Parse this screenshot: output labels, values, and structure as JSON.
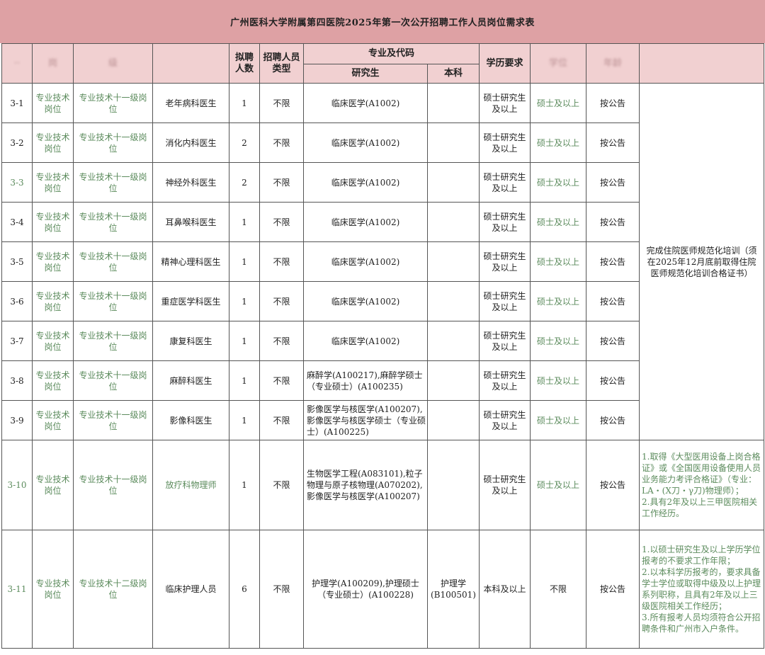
{
  "title": "广州医科大学附属第四医院2025年第一次公开招聘工作人员岗位需求表",
  "header": {
    "blur1": "··",
    "blur2": "岗",
    "blur3": "级",
    "num_label": "拟聘人数",
    "type_label": "招聘人员类型",
    "major_label": "专业及代码",
    "grad_label": "研究生",
    "bach_label": "本科",
    "edu_label": "学历要求",
    "blur4": "学位",
    "blur5": "年龄"
  },
  "rows": [
    {
      "code": "3-1",
      "cat": "专业技术岗位",
      "level": "专业技术十一级岗位",
      "post": "老年病科医生",
      "num": "1",
      "type": "不限",
      "grad": "临床医学(A1002)",
      "bach": "",
      "edu": "硕士研究生及以上",
      "degree": "硕士及以上",
      "age": "按公告"
    },
    {
      "code": "3-2",
      "cat": "专业技术岗位",
      "level": "专业技术十一级岗位",
      "post": "消化内科医生",
      "num": "2",
      "type": "不限",
      "grad": "临床医学(A1002)",
      "bach": "",
      "edu": "硕士研究生及以上",
      "degree": "硕士及以上",
      "age": "按公告"
    },
    {
      "code": "3-3",
      "cat": "专业技术岗位",
      "level": "专业技术十一级岗位",
      "post": "神经外科医生",
      "num": "2",
      "type": "不限",
      "grad": "临床医学(A1002)",
      "bach": "",
      "edu": "硕士研究生及以上",
      "degree": "硕士及以上",
      "age": "按公告"
    },
    {
      "code": "3-4",
      "cat": "专业技术岗位",
      "level": "专业技术十一级岗位",
      "post": "耳鼻喉科医生",
      "num": "1",
      "type": "不限",
      "grad": "临床医学(A1002)",
      "bach": "",
      "edu": "硕士研究生及以上",
      "degree": "硕士及以上",
      "age": "按公告"
    },
    {
      "code": "3-5",
      "cat": "专业技术岗位",
      "level": "专业技术十一级岗位",
      "post": "精神心理科医生",
      "num": "1",
      "type": "不限",
      "grad": "临床医学(A1002)",
      "bach": "",
      "edu": "硕士研究生及以上",
      "degree": "硕士及以上",
      "age": "按公告"
    },
    {
      "code": "3-6",
      "cat": "专业技术岗位",
      "level": "专业技术十一级岗位",
      "post": "重症医学科医生",
      "num": "1",
      "type": "不限",
      "grad": "临床医学(A1002)",
      "bach": "",
      "edu": "硕士研究生及以上",
      "degree": "硕士及以上",
      "age": "按公告"
    },
    {
      "code": "3-7",
      "cat": "专业技术岗位",
      "level": "专业技术十一级岗位",
      "post": "康复科医生",
      "num": "1",
      "type": "不限",
      "grad": "临床医学(A1002)",
      "bach": "",
      "edu": "硕士研究生及以上",
      "degree": "硕士及以上",
      "age": "按公告"
    },
    {
      "code": "3-8",
      "cat": "专业技术岗位",
      "level": "专业技术十一级岗位",
      "post": "麻醉科医生",
      "num": "1",
      "type": "不限",
      "grad": "麻醉学(A100217),麻醉学硕士（专业硕士）(A100235)",
      "bach": "",
      "edu": "硕士研究生及以上",
      "degree": "硕士及以上",
      "age": "按公告"
    },
    {
      "code": "3-9",
      "cat": "专业技术岗位",
      "level": "专业技术十一级岗位",
      "post": "影像科医生",
      "num": "1",
      "type": "不限",
      "grad": "影像医学与核医学(A100207),影像医学与核医学硕士（专业硕士）(A100225)",
      "bach": "",
      "edu": "硕士研究生及以上",
      "degree": "硕士及以上",
      "age": "按公告"
    },
    {
      "code": "3-10",
      "cat": "专业技术岗位",
      "level": "专业技术十一级岗位",
      "post": "放疗科物理师",
      "num": "1",
      "type": "不限",
      "grad": "生物医学工程(A083101),粒子物理与原子核物理(A070202),影像医学与核医学(A100207)",
      "bach": "",
      "edu": "硕士研究生及以上",
      "degree": "硕士及以上",
      "age": "按公告"
    },
    {
      "code": "3-11",
      "cat": "专业技术岗位",
      "level": "专业技术十二级岗位",
      "post": "临床护理人员",
      "num": "6",
      "type": "不限",
      "grad": "护理学(A100209),护理硕士（专业硕士）(A100228)",
      "bach": "护理学(B100501)",
      "edu": "本科及以上",
      "degree": "不限",
      "age": "按公告"
    }
  ],
  "notes": {
    "main": "完成住院医师规范化培训（须在2025年12月底前取得住院医师规范化培训合格证书）",
    "row10": "1.取得《大型医用设备上岗合格证》或《全国医用设备使用人员业务能力考评合格证》（专业：LA・(X刀・γ刀)物理师）；\n2.具有2年及以上三甲医院相关工作经历。",
    "row11": "1.以硕士研究生及以上学历学位报考的不要求工作年限；\n2.以本科学历报考的，要求具备学士学位或取得中级及以上护理系列职称，且具有2年及以上三级医院相关工作经历；\n3.所有报考人员均须符合公开招聘条件和广州市入户条件。"
  },
  "colors": {
    "title_bg": "#dea1a4",
    "header_bg": "#f1d0d1",
    "green_text": "#5b8b5c"
  }
}
